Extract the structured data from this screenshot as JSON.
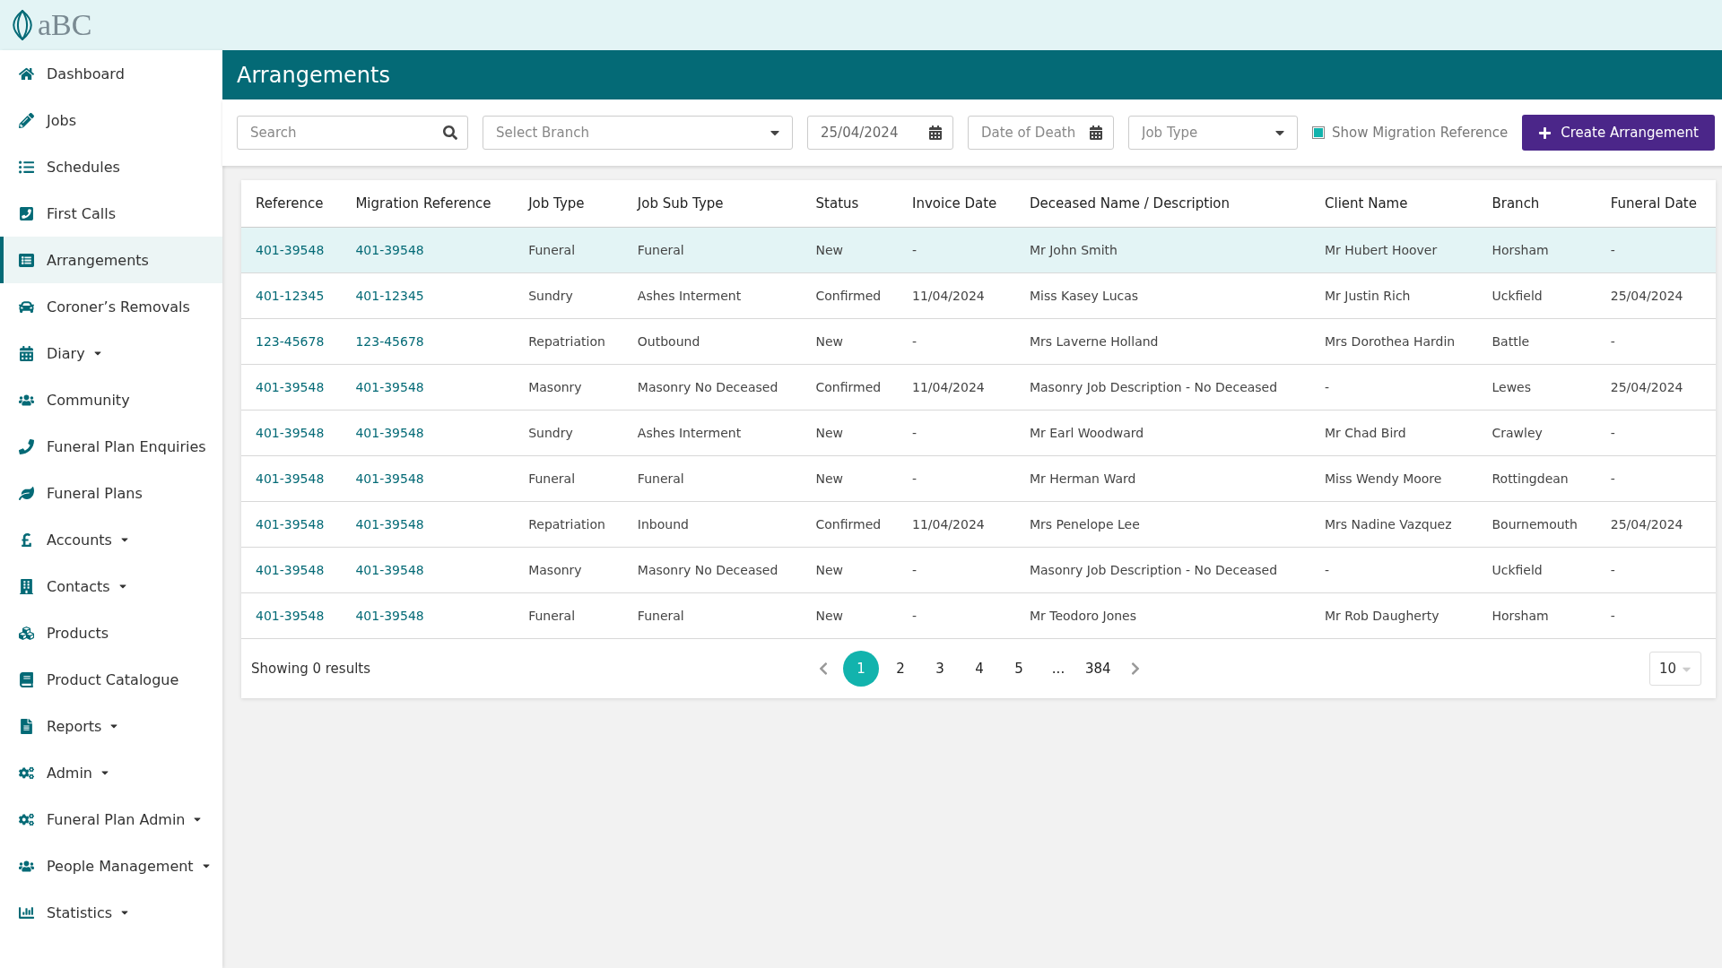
{
  "brand": {
    "name": "aBC"
  },
  "sidebar": {
    "items": [
      {
        "label": "Dashboard",
        "selected": false,
        "has_menu": false
      },
      {
        "label": "Jobs",
        "selected": false,
        "has_menu": false
      },
      {
        "label": "Schedules",
        "selected": false,
        "has_menu": false
      },
      {
        "label": "First Calls",
        "selected": false,
        "has_menu": false
      },
      {
        "label": "Arrangements",
        "selected": true,
        "has_menu": false
      },
      {
        "label": "Coroner’s Removals",
        "selected": false,
        "has_menu": false
      },
      {
        "label": "Diary",
        "selected": false,
        "has_menu": true
      },
      {
        "label": "Community",
        "selected": false,
        "has_menu": false
      },
      {
        "label": "Funeral Plan Enquiries",
        "selected": false,
        "has_menu": false
      },
      {
        "label": "Funeral Plans",
        "selected": false,
        "has_menu": false
      },
      {
        "label": "Accounts",
        "selected": false,
        "has_menu": true
      },
      {
        "label": "Contacts",
        "selected": false,
        "has_menu": true
      },
      {
        "label": "Products",
        "selected": false,
        "has_menu": false
      },
      {
        "label": "Product Catalogue",
        "selected": false,
        "has_menu": false
      },
      {
        "label": "Reports",
        "selected": false,
        "has_menu": true
      },
      {
        "label": "Admin",
        "selected": false,
        "has_menu": true
      },
      {
        "label": "Funeral Plan Admin",
        "selected": false,
        "has_menu": true
      },
      {
        "label": "People Management",
        "selected": false,
        "has_menu": true
      },
      {
        "label": "Statistics",
        "selected": false,
        "has_menu": true
      }
    ]
  },
  "page": {
    "title": "Arrangements"
  },
  "filters": {
    "search": {
      "placeholder": "Search"
    },
    "branch": {
      "placeholder": "Select Branch"
    },
    "date": {
      "value": "25/04/2024"
    },
    "date_of_death": {
      "placeholder": "Date of Death"
    },
    "job_type": {
      "placeholder": "Job Type"
    },
    "show_migration_reference": {
      "label": "Show Migration Reference",
      "checked": true
    },
    "create_button": "Create Arrangement"
  },
  "table": {
    "columns": [
      "Reference",
      "Migration Reference",
      "Job Type",
      "Job Sub Type",
      "Status",
      "Invoice Date",
      "Deceased Name / Description",
      "Client Name",
      "Branch",
      "Funeral Date"
    ],
    "rows": [
      {
        "selected": true,
        "cells": [
          "401-39548",
          "401-39548",
          "Funeral",
          "Funeral",
          "New",
          "-",
          "Mr John Smith",
          "Mr Hubert Hoover",
          "Horsham",
          "-"
        ]
      },
      {
        "selected": false,
        "cells": [
          "401-12345",
          "401-12345",
          "Sundry",
          "Ashes Interment",
          "Confirmed",
          "11/04/2024",
          "Miss Kasey Lucas",
          "Mr Justin Rich",
          "Uckfield",
          "25/04/2024"
        ]
      },
      {
        "selected": false,
        "cells": [
          "123-45678",
          "123-45678",
          "Repatriation",
          "Outbound",
          "New",
          "-",
          "Mrs Laverne Holland",
          "Mrs Dorothea Hardin",
          "Battle",
          "-"
        ]
      },
      {
        "selected": false,
        "cells": [
          "401-39548",
          "401-39548",
          "Masonry",
          "Masonry No Deceased",
          "Confirmed",
          "11/04/2024",
          "Masonry Job Description - No Deceased",
          "-",
          "Lewes",
          "25/04/2024"
        ]
      },
      {
        "selected": false,
        "cells": [
          "401-39548",
          "401-39548",
          "Sundry",
          "Ashes Interment",
          "New",
          "-",
          "Mr Earl Woodward",
          "Mr Chad Bird",
          "Crawley",
          "-"
        ]
      },
      {
        "selected": false,
        "cells": [
          "401-39548",
          "401-39548",
          "Funeral",
          "Funeral",
          "New",
          "-",
          "Mr Herman Ward",
          "Miss Wendy Moore",
          "Rottingdean",
          "-"
        ]
      },
      {
        "selected": false,
        "cells": [
          "401-39548",
          "401-39548",
          "Repatriation",
          "Inbound",
          "Confirmed",
          "11/04/2024",
          "Mrs Penelope Lee",
          "Mrs Nadine Vazquez",
          "Bournemouth",
          "25/04/2024"
        ]
      },
      {
        "selected": false,
        "cells": [
          "401-39548",
          "401-39548",
          "Masonry",
          "Masonry No Deceased",
          "New",
          "-",
          "Masonry Job Description - No Deceased",
          "-",
          "Uckfield",
          "-"
        ]
      },
      {
        "selected": false,
        "cells": [
          "401-39548",
          "401-39548",
          "Funeral",
          "Funeral",
          "New",
          "-",
          "Mr Teodoro Jones",
          "Mr Rob Daugherty",
          "Horsham",
          "-"
        ]
      }
    ]
  },
  "footer": {
    "summary": "Showing 0 results",
    "pages": [
      {
        "label": "1",
        "selected": true
      },
      {
        "label": "2",
        "selected": false
      },
      {
        "label": "3",
        "selected": false
      },
      {
        "label": "4",
        "selected": false
      },
      {
        "label": "5",
        "selected": false
      },
      {
        "label": "...",
        "selected": false
      },
      {
        "label": "384",
        "selected": false
      }
    ],
    "page_size": "10"
  }
}
